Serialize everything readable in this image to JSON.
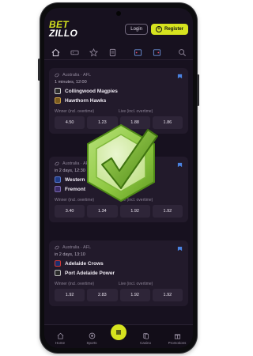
{
  "brand": {
    "line1": "BET",
    "line2": "ZILLO"
  },
  "header": {
    "login_label": "Login",
    "register_label": "Register"
  },
  "iconbar": [
    {
      "name": "home-icon"
    },
    {
      "name": "ticket-icon"
    },
    {
      "name": "star-icon"
    },
    {
      "name": "document-icon"
    },
    {
      "name": "filter-icon"
    },
    {
      "name": "refresh-icon"
    },
    {
      "name": "search-icon"
    }
  ],
  "matches": [
    {
      "league": "Australia · AFL",
      "time": "1 minutes, 12:00",
      "home": "Collingwood Magpies",
      "away": "Hawthorn Hawks",
      "market_left": "Winner (incl. overtime)",
      "market_right": "Live (incl. overtime)",
      "odds": [
        {
          "label": "",
          "value": "4.50"
        },
        {
          "label": "",
          "value": "1.23"
        },
        {
          "label": "",
          "value": "1.88"
        },
        {
          "label": "",
          "value": "1.86"
        }
      ]
    },
    {
      "league": "Australia · AFL",
      "time": "in 2 days, 12:30",
      "home": "Western",
      "away": "Fremont",
      "market_left": "Winner (incl. overtime)",
      "market_right": "Live (incl. overtime)",
      "odds": [
        {
          "label": "",
          "value": "3.40"
        },
        {
          "label": "",
          "value": "1.34"
        },
        {
          "label": "",
          "value": "1.92"
        },
        {
          "label": "",
          "value": "1.92"
        }
      ]
    },
    {
      "league": "Australia · AFL",
      "time": "in 2 days, 13:10",
      "home": "Adelaide Crows",
      "away": "Port Adelaide Power",
      "market_left": "Winner (incl. overtime)",
      "market_right": "Live (incl. overtime)",
      "odds": [
        {
          "label": "",
          "value": "1.92"
        },
        {
          "label": "",
          "value": "2.83"
        },
        {
          "label": "",
          "value": "1.92"
        },
        {
          "label": "",
          "value": "1.92"
        }
      ]
    }
  ],
  "bottomnav": {
    "home": "Home",
    "sports": "Sports",
    "casino": "Casino",
    "promotions": "Promotions"
  },
  "colors": {
    "accent": "#d6e31f",
    "screen_bg": "#17111f",
    "card_bg": "#221a2b",
    "badge_green": "#8cc63f"
  }
}
